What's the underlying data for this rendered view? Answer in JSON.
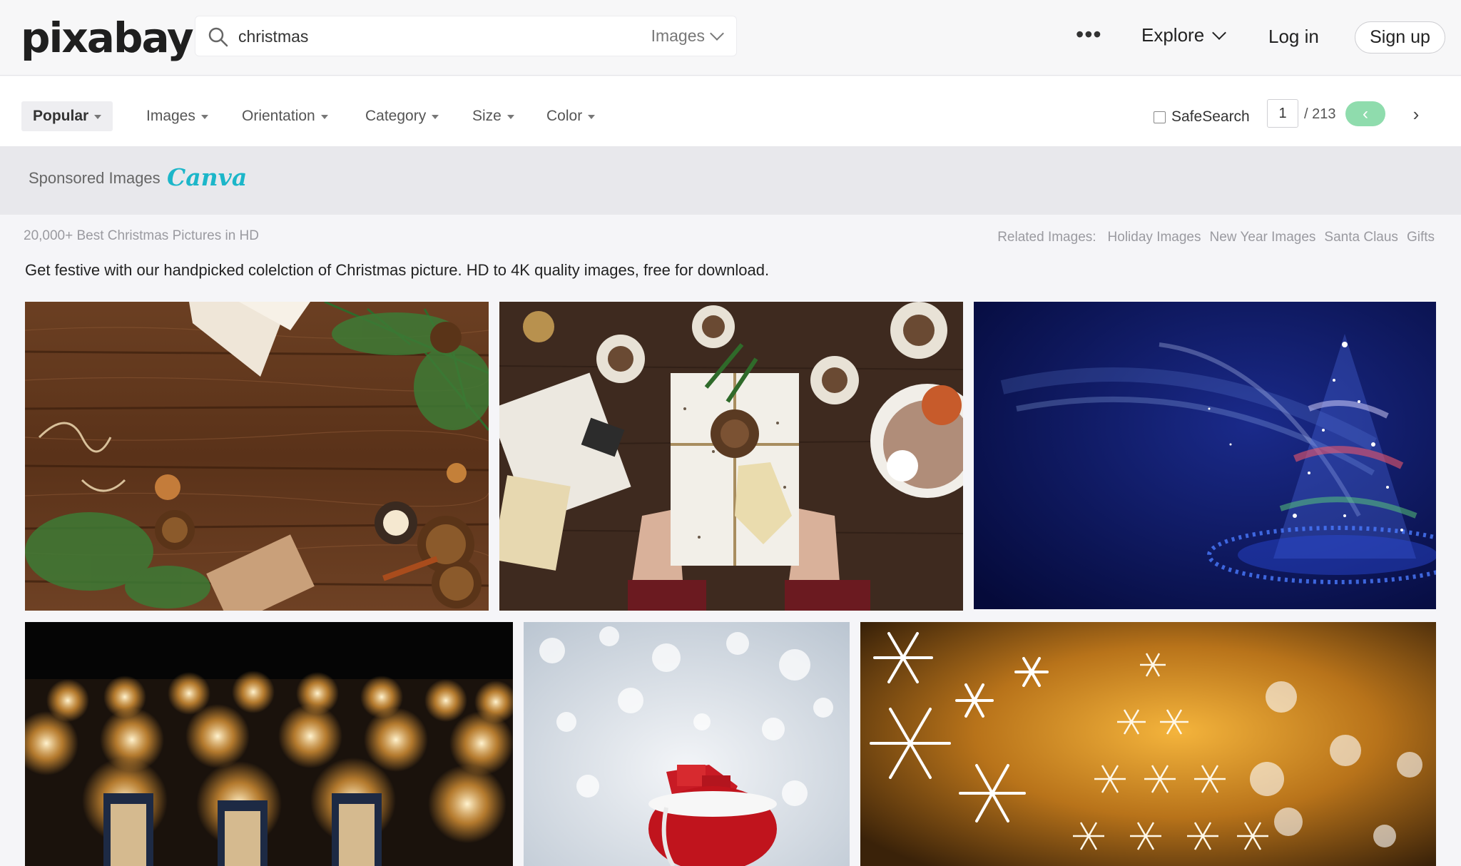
{
  "header": {
    "logo": "pixabay",
    "search": {
      "value": "christmas",
      "type_label": "Images"
    },
    "more": "•••",
    "explore": "Explore",
    "login": "Log in",
    "signup": "Sign up"
  },
  "filters": {
    "sort": "Popular",
    "items": [
      "Images",
      "Orientation",
      "Category",
      "Size",
      "Color"
    ],
    "safesearch": "SafeSearch",
    "page_current": "1",
    "page_total": "/ 213",
    "prev": "‹",
    "next": "›"
  },
  "sponsored": {
    "label": "Sponsored Images",
    "brand": "Canva"
  },
  "meta": {
    "title": "20,000+ Best Christmas Pictures in HD",
    "related_label": "Related Images:",
    "related": [
      "Holiday Images",
      "New Year Images",
      "Santa Claus",
      "Gifts"
    ],
    "description": "Get festive with our handpicked colelction of Christmas picture. HD to 4K quality images, free for download."
  },
  "images": [
    {
      "alt": "christmas decorations on wooden table"
    },
    {
      "alt": "hands holding wrapped gift with pine cones"
    },
    {
      "alt": "sparkling blue christmas tree"
    },
    {
      "alt": "rows of glowing lanterns at night"
    },
    {
      "alt": "santa gift sack in snowy bokeh"
    },
    {
      "alt": "golden snowflake christmas tree"
    }
  ],
  "colors": {
    "accent": "#8fdcad",
    "brand": "#1cb6c9"
  }
}
